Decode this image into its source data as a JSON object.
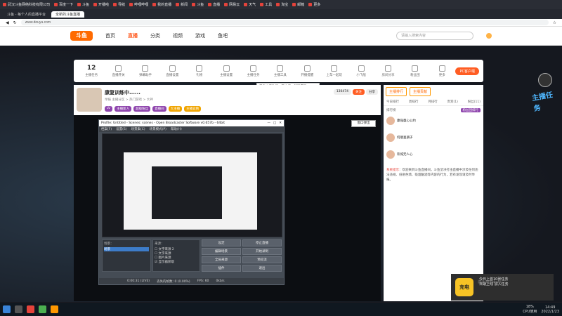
{
  "browser": {
    "bookmarks": [
      "武汉斗鱼网络科技有限公司",
      "百度一下",
      "斗鱼",
      "开播啦",
      "导航",
      "哔哩哔哩",
      "我的直播",
      "新闻",
      "斗鱼",
      "直播",
      "网易云",
      "天气",
      "工具",
      "淘宝",
      "邮箱",
      "更多"
    ],
    "tabs": [
      {
        "label": "斗鱼 - 每个人的直播平台",
        "active": false
      },
      {
        "label": "全新的斗鱼直播",
        "active": true
      }
    ],
    "url": "www.douyu.com"
  },
  "site_nav": {
    "logo": "斗鱼",
    "items": [
      "首页",
      "直播",
      "分类",
      "视频",
      "游戏",
      "鱼吧"
    ],
    "active_item": "直播",
    "search_placeholder": "请输入搜索内容"
  },
  "toolbar": {
    "day_count": "12",
    "day_label": "主播任务",
    "items": [
      "直播开关",
      "弹幕助手",
      "直播设置",
      "礼物",
      "主播设置",
      "主播任务",
      "主播工具",
      "开播提醒",
      "上车一起玩",
      "小飞船",
      "房间分享",
      "粉丝团",
      "更多"
    ],
    "pc_label": "PC客户端"
  },
  "tooltip": "开启上车功能，带主播一起玩游戏",
  "room": {
    "title": "康复训练中......",
    "sub": "举报  主播分区 > 热门游戏 > 大神",
    "tags": [
      "LV",
      "主播新人",
      "超级粉丝",
      "直播间",
      "大主播",
      "主播竞猜"
    ],
    "follow_count": "130474",
    "follow_label": "关注",
    "share_label": "分享"
  },
  "popout_label": "窗口弹出",
  "obs": {
    "title": "Profile: Untitled - Scenes: scenes - Open Broadcaster Software v0.657b - 64bit",
    "menu": [
      "档案(F)",
      "设置(S)",
      "场景集(C)",
      "场景模式(P)",
      "帮助(H)"
    ],
    "scenes_header": "场景：",
    "scenes": [
      "场景"
    ],
    "sources_header": "来源：",
    "sources": [
      "文字来源 2",
      "文字来源",
      "图片来源",
      "显示器获取"
    ],
    "buttons_left": [
      "设定",
      "编辑场景",
      "全局来源",
      "插件"
    ],
    "buttons_right": [
      "停止直播",
      "开始录制",
      "预览流",
      "退出"
    ],
    "status": [
      "0:00:31 (LIVE)",
      "丢失的帧数: 0 (0.00%)",
      "FPS: 60",
      "0kb/s"
    ]
  },
  "chat": {
    "tabs": [
      "主播排行",
      "主播贡献"
    ],
    "subtabs": [
      "今日排行",
      "周排行",
      "月排行",
      "贵宾(1)",
      "粉丝(11)"
    ],
    "rank_header": "排行榜",
    "fans_label": "粉丝团排行",
    "rank_rows": [
      "康强童心公约",
      "何顺喜朋子",
      "欢城无人心"
    ],
    "sys_label": "系统提示",
    "sys_msg": "欢迎来到斗鱼直播间，斗鱼坚决打击直播中涉及任何违法违规、低俗色情、吸烟酗酒等内容的行为，若有发现请及时举报。"
  },
  "toast": {
    "logo": "充电",
    "title": "今日上首10张任务",
    "line2": "日期上线 加入任务"
  },
  "watermark": "激活 Windows",
  "side_badge": "主播任务",
  "taskbar": {
    "cpu": "18%",
    "cpu_label": "CPU使用",
    "time": "14:49",
    "date": "2022/1/23"
  },
  "colors": {
    "accent": "#ff5d23",
    "chat_bg": "#ffffff",
    "obs_bg": "#454c55"
  }
}
